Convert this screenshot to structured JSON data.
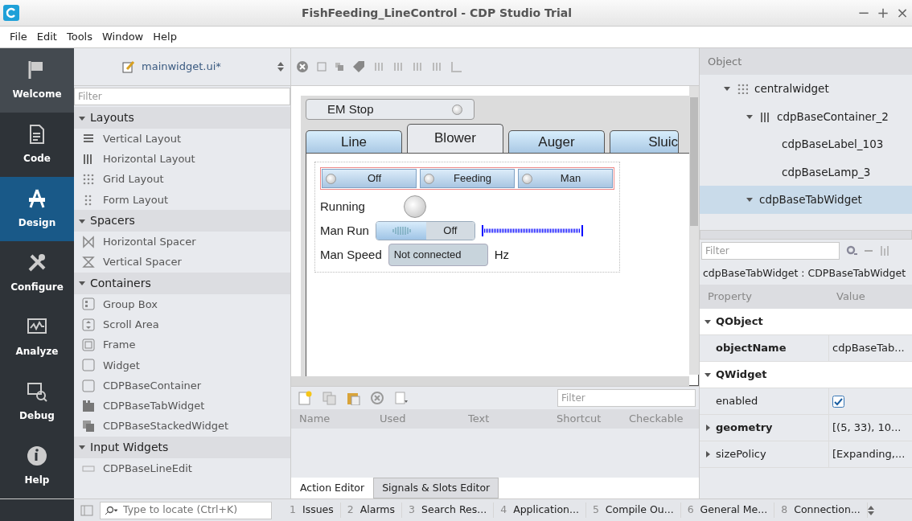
{
  "window": {
    "title": "FishFeeding_LineControl - CDP Studio Trial",
    "controls": [
      "−",
      "+",
      "×"
    ]
  },
  "menu": [
    "File",
    "Edit",
    "Tools",
    "Window",
    "Help"
  ],
  "modes": [
    {
      "label": "Welcome",
      "selected": false
    },
    {
      "label": "Code",
      "selected": false
    },
    {
      "label": "Design",
      "selected": true
    },
    {
      "label": "Configure",
      "selected": false
    },
    {
      "label": "Analyze",
      "selected": false
    },
    {
      "label": "Debug",
      "selected": false
    },
    {
      "label": "Help",
      "selected": false
    }
  ],
  "file_selector": {
    "value": "mainwidget.ui*"
  },
  "widget_box": {
    "filter_placeholder": "Filter",
    "groups": [
      {
        "label": "Layouts",
        "expanded": true,
        "items": [
          {
            "label": "Vertical Layout"
          },
          {
            "label": "Horizontal Layout"
          },
          {
            "label": "Grid Layout"
          },
          {
            "label": "Form Layout"
          }
        ]
      },
      {
        "label": "Spacers",
        "expanded": true,
        "items": [
          {
            "label": "Horizontal Spacer"
          },
          {
            "label": "Vertical Spacer"
          }
        ]
      },
      {
        "label": "Containers",
        "expanded": true,
        "items": [
          {
            "label": "Group Box"
          },
          {
            "label": "Scroll Area"
          },
          {
            "label": "Frame"
          },
          {
            "label": "Widget"
          },
          {
            "label": "CDPBaseContainer"
          },
          {
            "label": "CDPBaseTabWidget"
          },
          {
            "label": "CDPBaseStackedWidget"
          }
        ]
      },
      {
        "label": "Input Widgets",
        "expanded": true,
        "items": [
          {
            "label": "CDPBaseLineEdit"
          }
        ]
      }
    ]
  },
  "form": {
    "em_stop": "EM Stop",
    "tabs": [
      {
        "label": "Line",
        "selected": false
      },
      {
        "label": "Blower",
        "selected": true
      },
      {
        "label": "Auger",
        "selected": false
      },
      {
        "label": "Sluic",
        "selected": false
      }
    ],
    "mode_buttons": [
      {
        "label": "Off"
      },
      {
        "label": "Feeding"
      },
      {
        "label": "Man"
      }
    ],
    "running_label": "Running",
    "man_run_label": "Man Run",
    "man_run_toggle": {
      "label": "Off",
      "on": false
    },
    "man_speed_label": "Man Speed",
    "man_speed_value": "Not connected",
    "man_speed_unit": "Hz"
  },
  "action_editor": {
    "filter_placeholder": "Filter",
    "columns": [
      "Name",
      "Used",
      "Text",
      "Shortcut",
      "Checkable"
    ],
    "tabs": [
      {
        "label": "Action Editor",
        "selected": true
      },
      {
        "label": "Signals & Slots Editor",
        "selected": false
      }
    ]
  },
  "object_inspector": {
    "header": "Object",
    "tree": [
      {
        "label": "centralwidget",
        "expanded": true,
        "selected": false,
        "children": [
          {
            "label": "cdpBaseContainer_2",
            "expanded": true,
            "selected": false,
            "children": [
              {
                "label": "cdpBaseLabel_103",
                "selected": false
              },
              {
                "label": "cdpBaseLamp_3",
                "selected": false
              }
            ]
          },
          {
            "label": "cdpBaseTabWidget",
            "expanded": true,
            "selected": true
          }
        ]
      }
    ]
  },
  "property_editor": {
    "filter_placeholder": "Filter",
    "object": "cdpBaseTabWidget : CDPBaseTabWidget",
    "columns": [
      "Property",
      "Value"
    ],
    "rows": [
      {
        "kind": "group",
        "name": "QObject",
        "expanded": true
      },
      {
        "kind": "text",
        "name": "objectName",
        "bold": true,
        "value": "cdpBaseTab..."
      },
      {
        "kind": "group",
        "name": "QWidget",
        "expanded": true
      },
      {
        "kind": "check",
        "name": "enabled",
        "bold": false,
        "checked": true
      },
      {
        "kind": "text",
        "name": "geometry",
        "bold": true,
        "value": "[(5, 33), 10...",
        "expandable": true
      },
      {
        "kind": "text",
        "name": "sizePolicy",
        "bold": false,
        "value": "[Expanding,...",
        "expandable": true
      }
    ]
  },
  "status_bar": {
    "locate_placeholder": "Type to locate (Ctrl+K)",
    "panes": [
      {
        "number": "1",
        "label": "Issues"
      },
      {
        "number": "2",
        "label": "Alarms"
      },
      {
        "number": "3",
        "label": "Search Res..."
      },
      {
        "number": "4",
        "label": "Application..."
      },
      {
        "number": "5",
        "label": "Compile Ou..."
      },
      {
        "number": "6",
        "label": "General Me..."
      },
      {
        "number": "8",
        "label": "Connection..."
      }
    ]
  }
}
